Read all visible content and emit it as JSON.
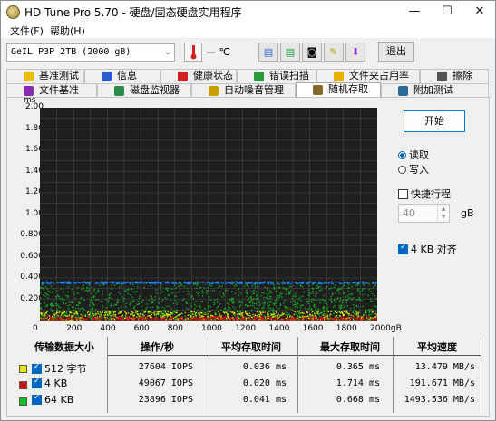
{
  "window": {
    "title": "HD Tune Pro 5.70 - 硬盘/固态硬盘实用程序",
    "min_label": "—",
    "max_label": "☐",
    "close_label": "✕"
  },
  "menu": [
    {
      "label": "文件(F)"
    },
    {
      "label": "帮助(H)"
    }
  ],
  "toolbar": {
    "drive": "GeIL P3P 2TB (2000 gB)",
    "temperature": "— ℃",
    "exit_label": "退出"
  },
  "tabs_row1": [
    {
      "label": "基准测试",
      "icon": "bulb-icon"
    },
    {
      "label": "信息",
      "icon": "info-icon"
    },
    {
      "label": "健康状态",
      "icon": "health-icon"
    },
    {
      "label": "错误扫描",
      "icon": "magnifier-icon"
    },
    {
      "label": "文件夹占用率",
      "icon": "folder-icon"
    },
    {
      "label": "擦除",
      "icon": "trash-icon"
    }
  ],
  "tabs_row2": [
    {
      "label": "文件基准",
      "icon": "file-icon"
    },
    {
      "label": "磁盘监视器",
      "icon": "monitor-icon"
    },
    {
      "label": "自动噪音管理",
      "icon": "speaker-icon"
    },
    {
      "label": "随机存取",
      "icon": "random-icon",
      "active": true
    },
    {
      "label": "附加测试",
      "icon": "extra-icon"
    }
  ],
  "controls": {
    "start_label": "开始",
    "read_label": "读取",
    "write_label": "写入",
    "quick_label": "快捷行程",
    "quick_value": "40",
    "quick_unit": "gB",
    "align_label": "4 KB 对齐"
  },
  "chart_data": {
    "type": "scatter",
    "ylabel": "ms",
    "yticks": [
      "2.00",
      "1.80",
      "1.60",
      "1.40",
      "1.20",
      "1.00",
      "0.800",
      "0.600",
      "0.400",
      "0.200"
    ],
    "xticks": [
      "0",
      "200",
      "400",
      "600",
      "800",
      "1000",
      "1200",
      "1400",
      "1600",
      "1800",
      "2000gB"
    ],
    "xlim": [
      0,
      2000
    ],
    "ylim": [
      0,
      2.0
    ],
    "grid": true,
    "series": [
      {
        "name": "512 字节",
        "color": "#e8e800",
        "band": [
          0.0,
          0.09
        ]
      },
      {
        "name": "4 KB",
        "color": "#d01010",
        "band": [
          0.0,
          0.04
        ]
      },
      {
        "name": "64 KB",
        "color": "#10c020",
        "band": [
          0.0,
          0.36
        ]
      },
      {
        "name": "",
        "color": "#1e8aff",
        "band": [
          0.35,
          0.37
        ]
      }
    ]
  },
  "stats": {
    "headers": [
      "传输数据大小",
      "操作/秒",
      "平均存取时间",
      "最大存取时间",
      "平均速度"
    ],
    "rows": [
      {
        "label": "512 字节",
        "color": "#e8e800",
        "ops": "27604 IOPS",
        "avg": "0.036 ms",
        "max": "0.365 ms",
        "speed": "13.479 MB/s"
      },
      {
        "label": "4 KB",
        "color": "#d01010",
        "ops": "49067 IOPS",
        "avg": "0.020 ms",
        "max": "1.714 ms",
        "speed": "191.671 MB/s"
      },
      {
        "label": "64 KB",
        "color": "#10c020",
        "ops": "23896 IOPS",
        "avg": "0.041 ms",
        "max": "0.668 ms",
        "speed": "1493.536 MB/s"
      }
    ]
  }
}
